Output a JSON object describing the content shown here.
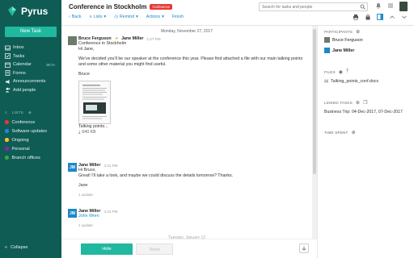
{
  "app": {
    "name": "Pyrus",
    "new_task": "New Task",
    "collapse": "Collapse"
  },
  "nav": [
    {
      "label": "Inbox",
      "icon": "inbox-icon",
      "badge": ""
    },
    {
      "label": "Tasks",
      "icon": "tasks-icon",
      "badge": ""
    },
    {
      "label": "Calendar",
      "icon": "calendar-icon",
      "badge": "BETA"
    },
    {
      "label": "Forms",
      "icon": "forms-icon",
      "badge": ""
    },
    {
      "label": "Announcements",
      "icon": "announcements-icon",
      "badge": ""
    },
    {
      "label": "Add people",
      "icon": "add-people-icon",
      "badge": ""
    }
  ],
  "lists_header": "LISTS",
  "lists": [
    {
      "label": "Conference",
      "color": "#e53935"
    },
    {
      "label": "Software updates",
      "color": "#1e88e5"
    },
    {
      "label": "Ongoing",
      "color": "#fbc02d"
    },
    {
      "label": "Personal",
      "color": "#8e24aa"
    },
    {
      "label": "Branch offices",
      "color": "#43a047"
    }
  ],
  "header": {
    "title": "Conference in Stockholm",
    "tag": "Conference",
    "search_placeholder": "Search for tasks and people",
    "toolbar": {
      "back": "Back",
      "lists": "Lists",
      "remind": "Remind",
      "actions": "Actions",
      "finish": "Finish"
    }
  },
  "feed": {
    "date": "Monday, November 27, 2017",
    "msg1": {
      "author": "Bruce Ferguson",
      "to": "Jane Miller",
      "time": "1:27 PM",
      "subject": "Conference in Stockholm",
      "greeting": "Hi Jane,",
      "text": "We've decided you'll be our speaker at the conference this year. Please find attached a file with our main talking points and some other material you might find useful.",
      "sign": "Bruce",
      "file": "Talking points...",
      "file_size": "640 KB"
    },
    "msg2": {
      "author": "Jane Miller",
      "time": "3:31 PM",
      "greeting": "Hi Bruce,",
      "text": "Great! I'll take a look, and maybe we could discuss the details tomorrow? Thanks.",
      "sign": "Jane",
      "updates": "1 update"
    },
    "msg3": {
      "author": "Jane Miller",
      "time": "4:10 PM",
      "text": "John Wren",
      "updates": "1 update"
    },
    "date2": "Tuesday, January 12"
  },
  "bottom": {
    "hide": "Hide",
    "send": "Send"
  },
  "right": {
    "participants_title": "PARTICIPANTS",
    "participants": [
      "Bruce Ferguson",
      "Jane Miller"
    ],
    "files_title": "FILES",
    "file": "Talking_points_conf.docx",
    "linked_title": "LINKED TASKS",
    "linked": "Business Trip: 04-Dec-2017, 07-Dec-2017",
    "time_title": "TIME SPENT"
  }
}
